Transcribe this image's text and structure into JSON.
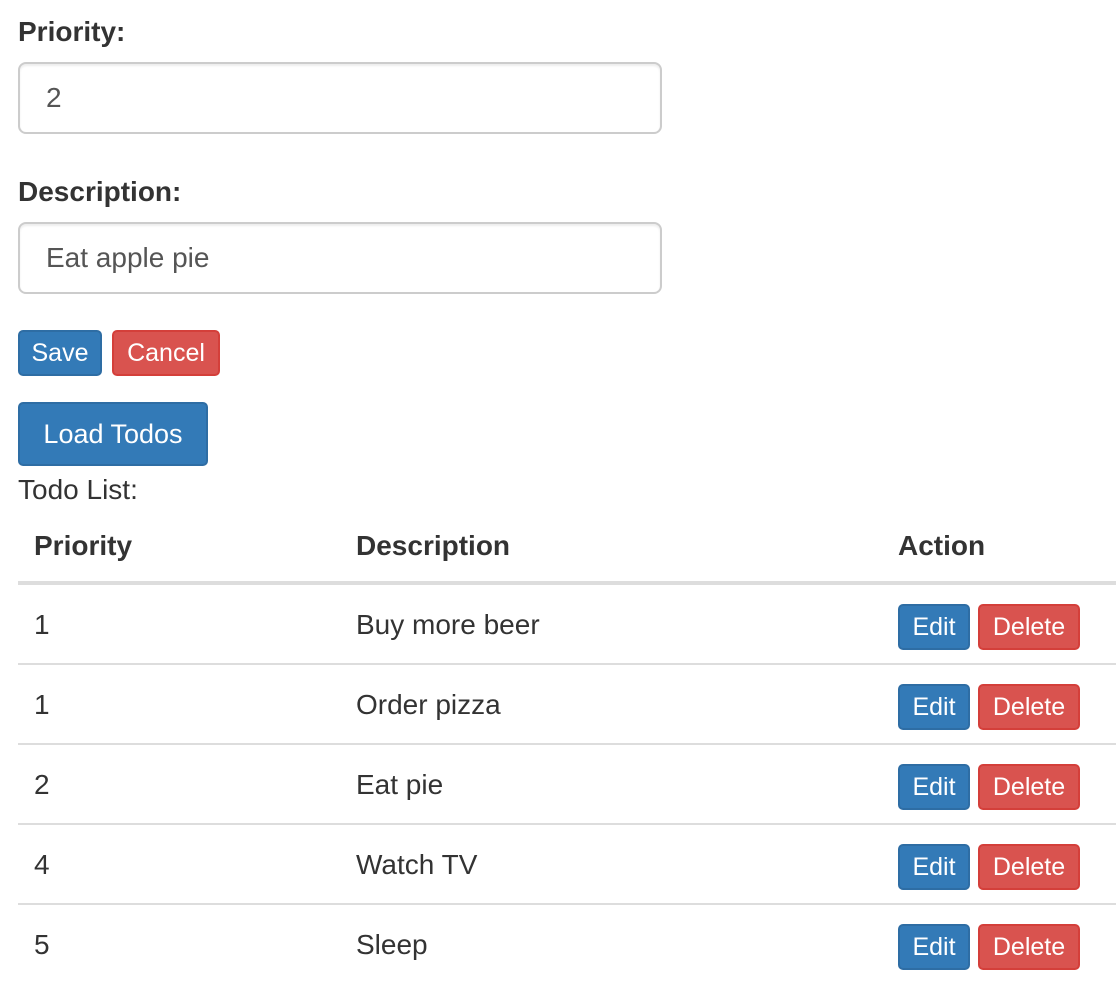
{
  "form": {
    "priority_label": "Priority:",
    "priority_value": "2",
    "description_label": "Description:",
    "description_value": "Eat apple pie",
    "save_label": "Save",
    "cancel_label": "Cancel"
  },
  "load_todos_label": "Load Todos",
  "todo_list_label": "Todo List:",
  "table": {
    "headers": [
      "Priority",
      "Description",
      "Action"
    ],
    "edit_label": "Edit",
    "delete_label": "Delete",
    "rows": [
      {
        "priority": "1",
        "description": "Buy more beer"
      },
      {
        "priority": "1",
        "description": "Order pizza"
      },
      {
        "priority": "2",
        "description": "Eat pie"
      },
      {
        "priority": "4",
        "description": "Watch TV"
      },
      {
        "priority": "5",
        "description": "Sleep"
      }
    ]
  },
  "colors": {
    "primary": "#337ab7",
    "danger": "#d9534f"
  }
}
